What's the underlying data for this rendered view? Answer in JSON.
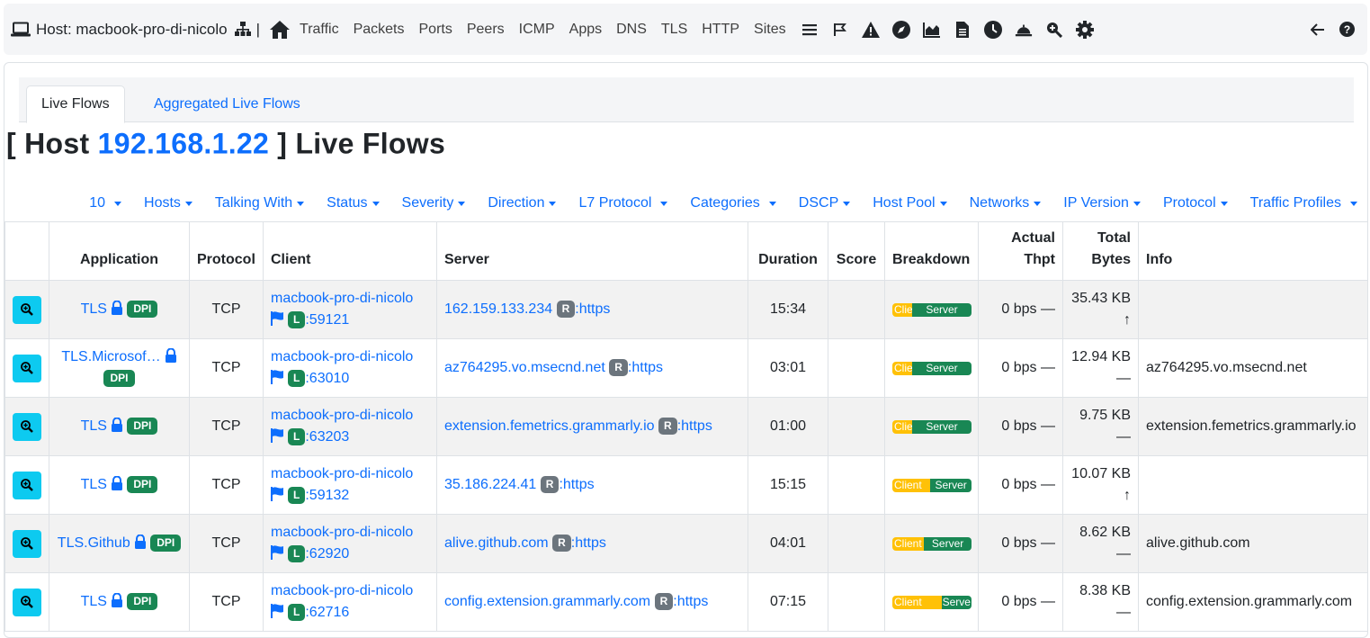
{
  "header": {
    "host_title": "Host: macbook-pro-di-nicolo",
    "separator": "|",
    "nav_links": [
      "Traffic",
      "Packets",
      "Ports",
      "Peers",
      "ICMP",
      "Apps",
      "DNS",
      "TLS",
      "HTTP",
      "Sites"
    ]
  },
  "tabs": [
    {
      "label": "Live Flows",
      "active": true
    },
    {
      "label": "Aggregated Live Flows",
      "active": false
    }
  ],
  "title": {
    "prefix": "[ Host ",
    "ip": "192.168.1.22",
    "suffix": " ] Live Flows"
  },
  "filters": [
    "10",
    "Hosts",
    "Talking With",
    "Status",
    "Severity",
    "Direction",
    "L7 Protocol",
    "Categories",
    "DSCP",
    "Host Pool",
    "Networks",
    "IP Version",
    "Protocol",
    "Traffic Profiles"
  ],
  "columns": {
    "application": "Application",
    "protocol": "Protocol",
    "client": "Client",
    "server": "Server",
    "duration": "Duration",
    "score": "Score",
    "breakdown": "Breakdown",
    "actual_thpt_1": "Actual",
    "actual_thpt_2": "Thpt",
    "total_bytes_1": "Total",
    "total_bytes_2": "Bytes",
    "info": "Info"
  },
  "badges": {
    "dpi": "DPI",
    "local": "L",
    "remote": "R"
  },
  "rows": [
    {
      "app": "TLS",
      "proto": "TCP",
      "client_host": "macbook-pro-di-nicolo",
      "client_port": ":59121",
      "server_host": "162.159.133.234",
      "server_port": ":https",
      "duration": "15:34",
      "score": "",
      "bd_client": "Client",
      "bd_server": "Server",
      "bd_client_frac": 0.25,
      "thpt": "0 bps",
      "thpt_trend": "—",
      "bytes": "35.43 KB",
      "bytes_trend": "↑",
      "info": ""
    },
    {
      "app": "TLS.Microsof…",
      "proto": "TCP",
      "client_host": "macbook-pro-di-nicolo",
      "client_port": ":63010",
      "server_host": "az764295.vo.msecnd.net",
      "server_port": ":https",
      "duration": "03:01",
      "score": "",
      "bd_client": "Client",
      "bd_server": "Server",
      "bd_client_frac": 0.25,
      "thpt": "0 bps",
      "thpt_trend": "—",
      "bytes": "12.94 KB",
      "bytes_trend": "—",
      "info": "az764295.vo.msecnd.net"
    },
    {
      "app": "TLS",
      "proto": "TCP",
      "client_host": "macbook-pro-di-nicolo",
      "client_port": ":63203",
      "server_host": "extension.femetrics.grammarly.io",
      "server_port": ":https",
      "duration": "01:00",
      "score": "",
      "bd_client": "Client",
      "bd_server": "Server",
      "bd_client_frac": 0.25,
      "thpt": "0 bps",
      "thpt_trend": "—",
      "bytes": "9.75 KB",
      "bytes_trend": "—",
      "info": "extension.femetrics.grammarly.io"
    },
    {
      "app": "TLS",
      "proto": "TCP",
      "client_host": "macbook-pro-di-nicolo",
      "client_port": ":59132",
      "server_host": "35.186.224.41",
      "server_port": ":https",
      "duration": "15:15",
      "score": "",
      "bd_client": "Client",
      "bd_server": "Server",
      "bd_client_frac": 0.48,
      "thpt": "0 bps",
      "thpt_trend": "—",
      "bytes": "10.07 KB",
      "bytes_trend": "↑",
      "info": ""
    },
    {
      "app": "TLS.Github",
      "proto": "TCP",
      "client_host": "macbook-pro-di-nicolo",
      "client_port": ":62920",
      "server_host": "alive.github.com",
      "server_port": ":https",
      "duration": "04:01",
      "score": "",
      "bd_client": "Client",
      "bd_server": "Server",
      "bd_client_frac": 0.4,
      "thpt": "0 bps",
      "thpt_trend": "—",
      "bytes": "8.62 KB",
      "bytes_trend": "—",
      "info": "alive.github.com"
    },
    {
      "app": "TLS",
      "proto": "TCP",
      "client_host": "macbook-pro-di-nicolo",
      "client_port": ":62716",
      "server_host": "config.extension.grammarly.com",
      "server_port": ":https",
      "duration": "07:15",
      "score": "",
      "bd_client": "Client",
      "bd_server": "Serve",
      "bd_client_frac": 0.62,
      "thpt": "0 bps",
      "thpt_trend": "—",
      "bytes": "8.38 KB",
      "bytes_trend": "—",
      "info": "config.extension.grammarly.com"
    }
  ]
}
